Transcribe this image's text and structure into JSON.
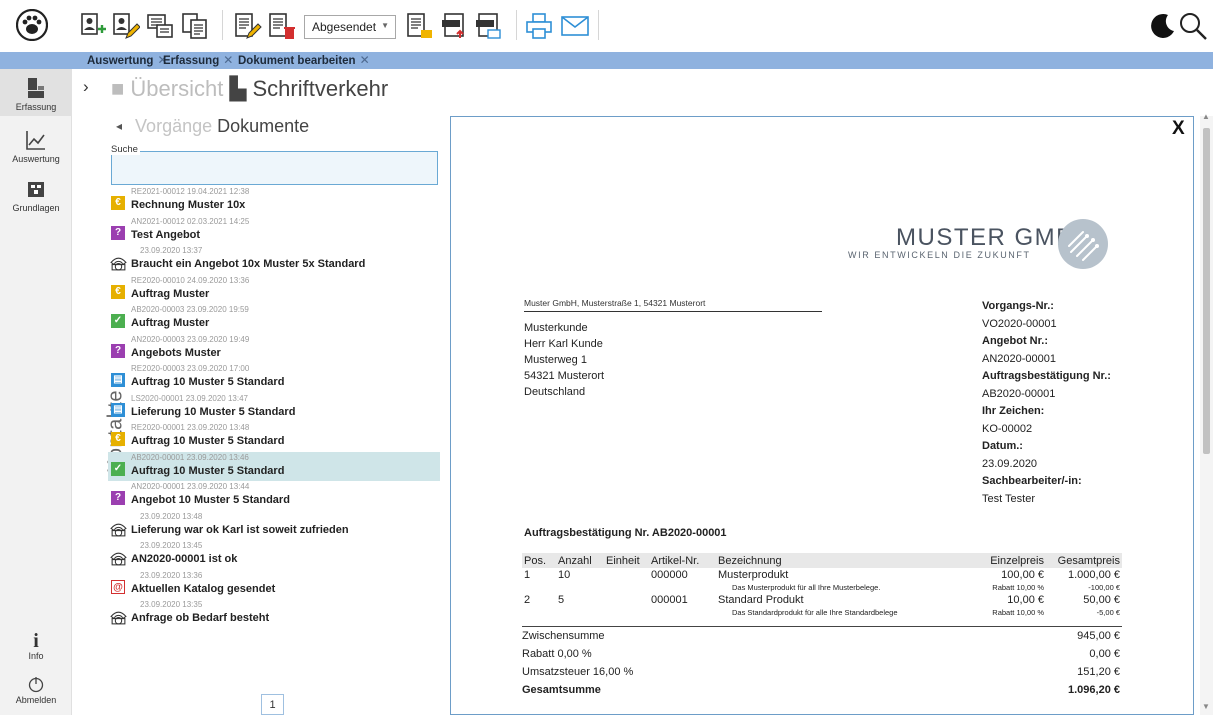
{
  "toolbar": {
    "status_select": "Abgesendet",
    "icons": [
      "paw-logo-icon",
      "contact-add-icon",
      "contact-edit-icon",
      "document-new-icon",
      "document-copy-icon",
      "document-edit-icon",
      "document-delete-icon",
      "document-lock-icon",
      "export-pdf-icon",
      "export-xml-icon",
      "print-icon",
      "email-icon",
      "moon-icon",
      "search-icon"
    ]
  },
  "tabs": [
    {
      "label": "Auswertung"
    },
    {
      "label": "Erfassung"
    },
    {
      "label": "Dokument bearbeiten"
    }
  ],
  "nav": {
    "items": [
      {
        "label": "Erfassung",
        "icon": "erfassung-icon"
      },
      {
        "label": "Auswertung",
        "icon": "chart-icon"
      },
      {
        "label": "Grundlagen",
        "icon": "grundlagen-icon"
      }
    ],
    "info_label": "Info",
    "logout_label": "Abmelden"
  },
  "breadcrumb": {
    "muted": "Übersicht",
    "current": "Schriftverkehr"
  },
  "subnav": {
    "muted": "Vorgänge",
    "current": "Dokumente"
  },
  "side_label": "Kontakte",
  "search": {
    "legend": "Suche",
    "value": ""
  },
  "documents": [
    {
      "meta": "RE2021-00012  19.04.2021 12:38",
      "title": "Rechnung Muster 10x",
      "type": "rechnung",
      "color": "#e6b000",
      "selected": false
    },
    {
      "meta": "AN2021-00012  02.03.2021 14:25",
      "title": "Test Angebot",
      "type": "angebot",
      "color": "#9b3fb0",
      "selected": false
    },
    {
      "meta": "23.09.2020 13:37",
      "title": "Braucht ein Angebot 10x Muster 5x Standard",
      "type": "telefon",
      "color": "#ffffff",
      "selected": false
    },
    {
      "meta": "RE2020-00010  24.09.2020 13:36",
      "title": "Auftrag Muster",
      "type": "rechnung",
      "color": "#e6b000",
      "selected": false
    },
    {
      "meta": "AB2020-00003  23.09.2020 19:59",
      "title": "Auftrag Muster",
      "type": "bestaetigung",
      "color": "#4caf50",
      "selected": false
    },
    {
      "meta": "AN2020-00003  23.09.2020 19:49",
      "title": "Angebots Muster",
      "type": "angebot",
      "color": "#9b3fb0",
      "selected": false
    },
    {
      "meta": "RE2020-00003  23.09.2020 17:00",
      "title": "Auftrag 10 Muster 5 Standard",
      "type": "lieferung",
      "color": "#2e8fd6",
      "selected": false
    },
    {
      "meta": "LS2020-00001  23.09.2020 13:47",
      "title": "Lieferung 10 Muster 5 Standard",
      "type": "lieferung",
      "color": "#2e8fd6",
      "selected": false
    },
    {
      "meta": "RE2020-00001  23.09.2020 13:48",
      "title": "Auftrag 10 Muster 5 Standard",
      "type": "rechnung",
      "color": "#e6b000",
      "selected": false
    },
    {
      "meta": "AB2020-00001  23.09.2020 13:46",
      "title": "Auftrag 10 Muster 5 Standard",
      "type": "bestaetigung",
      "color": "#4caf50",
      "selected": true
    },
    {
      "meta": "AN2020-00001  23.09.2020 13:44",
      "title": "Angebot 10 Muster 5 Standard",
      "type": "angebot",
      "color": "#9b3fb0",
      "selected": false
    },
    {
      "meta": "23.09.2020 13:48",
      "title": "Lieferung war ok Karl ist soweit zufrieden",
      "type": "telefon",
      "color": "#ffffff",
      "selected": false
    },
    {
      "meta": "23.09.2020 13:45",
      "title": "AN2020-00001 ist ok",
      "type": "telefon",
      "color": "#ffffff",
      "selected": false
    },
    {
      "meta": "23.09.2020 13:36",
      "title": "Aktuellen Katalog gesendet",
      "type": "email",
      "color": "#d32f2f",
      "selected": false
    },
    {
      "meta": "23.09.2020 13:35",
      "title": "Anfrage ob Bedarf besteht",
      "type": "telefon",
      "color": "#ffffff",
      "selected": false
    }
  ],
  "pager": {
    "page": "1"
  },
  "preview": {
    "close": "X",
    "logo_name": "MUSTER GMBH",
    "logo_slogan": "WIR ENTWICKELN DIE ZUKUNFT",
    "sender_line": "Muster GmbH, Musterstraße 1, 54321 Musterort",
    "address": [
      "Musterkunde",
      "Herr Karl Kunde",
      "Musterweg 1",
      "54321 Musterort",
      "Deutschland"
    ],
    "info": [
      {
        "label": "Vorgangs-Nr.:",
        "value": "VO2020-00001"
      },
      {
        "label": "Angebot Nr.:",
        "value": "AN2020-00001"
      },
      {
        "label": "Auftragsbestätigung Nr.:",
        "value": "AB2020-00001"
      },
      {
        "label": "Ihr Zeichen:",
        "value": "KO-00002"
      },
      {
        "label": "Datum.:",
        "value": "23.09.2020"
      },
      {
        "label": "Sachbearbeiter/-in:",
        "value": "Test Tester"
      }
    ],
    "heading": "Auftragsbestätigung Nr. AB2020-00001",
    "columns": [
      "Pos.",
      "Anzahl",
      "Einheit",
      "Artikel-Nr.",
      "Bezeichnung",
      "Einzelpreis",
      "Gesamtpreis"
    ],
    "rows": [
      {
        "pos": "1",
        "anzahl": "10",
        "einheit": "",
        "artikel": "000000",
        "bezeichnung": "Musterprodukt",
        "einzel": "100,00 €",
        "gesamt": "1.000,00 €",
        "desc": "Das Musterprodukt für all Ihre Musterbelege.",
        "rabatt": "Rabatt 10,00 %",
        "rabatt_betrag": "-100,00 €"
      },
      {
        "pos": "2",
        "anzahl": "5",
        "einheit": "",
        "artikel": "000001",
        "bezeichnung": "Standard Produkt",
        "einzel": "10,00 €",
        "gesamt": "50,00 €",
        "desc": "Das Standardprodukt für alle Ihre Standardbelege",
        "rabatt": "Rabatt 10,00 %",
        "rabatt_betrag": "-5,00 €"
      }
    ],
    "totals": [
      {
        "label": "Zwischensumme",
        "value": "945,00 €",
        "bold": false
      },
      {
        "label": "Rabatt 0,00 %",
        "value": "0,00 €",
        "bold": false
      },
      {
        "label": "Umsatzsteuer 16,00 %",
        "value": "151,20 €",
        "bold": false
      },
      {
        "label": "Gesamtsumme",
        "value": "1.096,20 €",
        "bold": true
      }
    ]
  }
}
